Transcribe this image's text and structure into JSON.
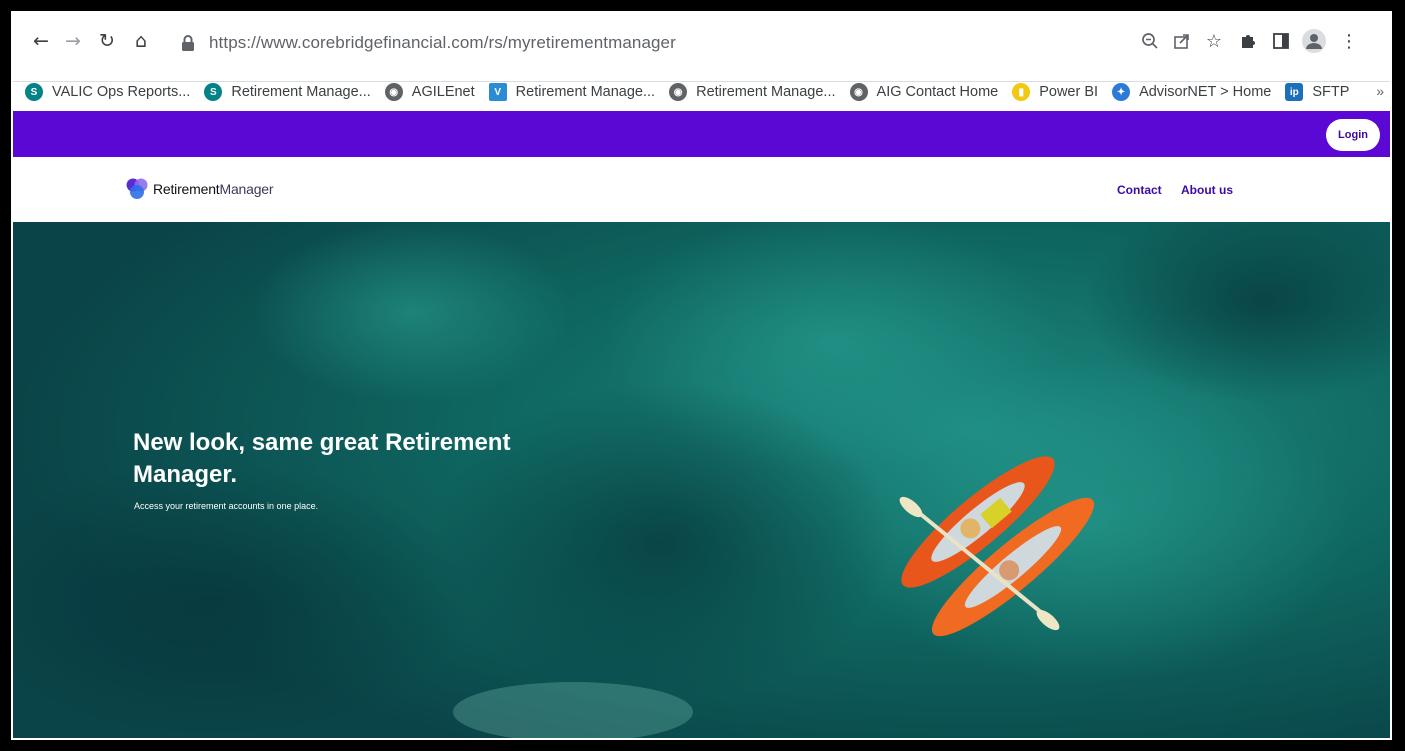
{
  "browser": {
    "url_host": "https://www.corebridgefinancial.com",
    "url_path": "/rs/myretirementmanager",
    "bookmarks": [
      {
        "label": "VALIC Ops Reports...",
        "icon": "sharepoint-icon",
        "color": "#038387"
      },
      {
        "label": "Retirement Manage...",
        "icon": "sharepoint-icon",
        "color": "#038387"
      },
      {
        "label": "AGILEnet",
        "icon": "globe-icon",
        "color": "#5f6368"
      },
      {
        "label": "Retirement Manage...",
        "icon": "valic-icon",
        "color": "#2a8dd4"
      },
      {
        "label": "Retirement Manage...",
        "icon": "globe-icon",
        "color": "#5f6368"
      },
      {
        "label": "AIG Contact Home",
        "icon": "globe-icon",
        "color": "#5f6368"
      },
      {
        "label": "Power BI",
        "icon": "powerbi-icon",
        "color": "#f2c811"
      },
      {
        "label": "AdvisorNET > Home",
        "icon": "advisornet-icon",
        "color": "#2b7bd6"
      },
      {
        "label": "SFTP",
        "icon": "ip-icon",
        "color": "#1d6fb8"
      }
    ],
    "more_bookmarks": "»"
  },
  "site": {
    "colors": {
      "brand_purple": "#5b08d4",
      "nav_purple": "#3a0ba2"
    },
    "login_label": "Login",
    "logo_bold": "Retirement",
    "logo_light": "Manager",
    "nav": {
      "contact": "Contact",
      "about": "About us"
    },
    "hero": {
      "title": "New look, same great Retirement Manager.",
      "subtitle": "Access your retirement accounts in one place."
    }
  }
}
